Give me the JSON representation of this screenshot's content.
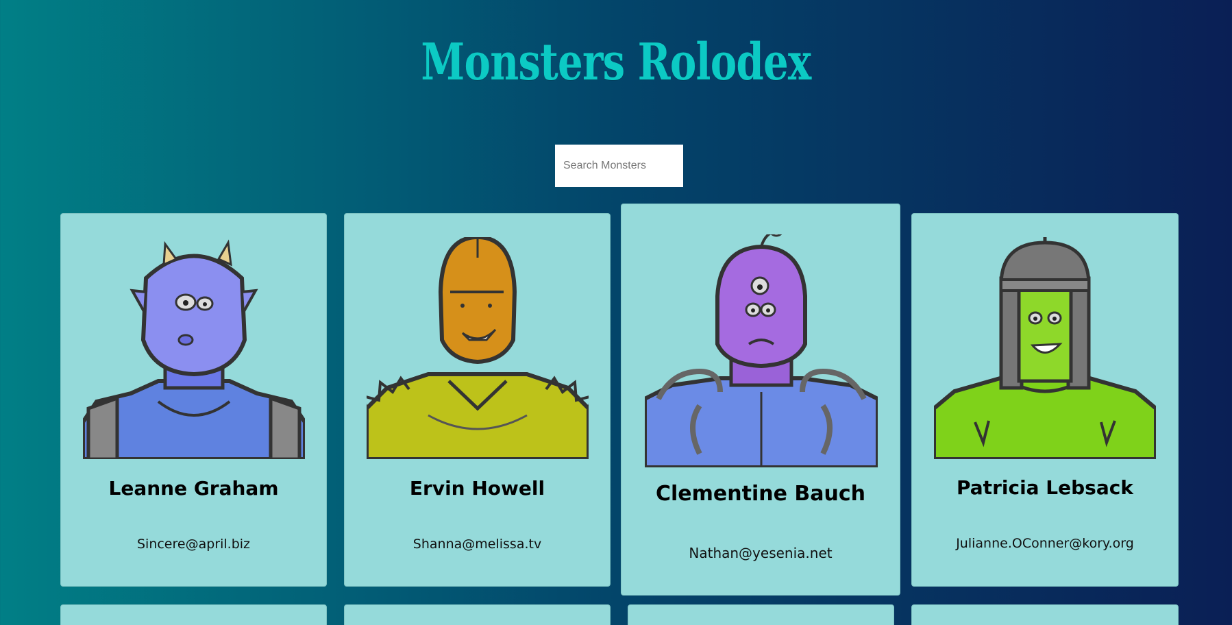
{
  "header": {
    "title": "Monsters Rolodex"
  },
  "search": {
    "placeholder": "Search Monsters"
  },
  "monsters": [
    {
      "name": "Leanne Graham",
      "email": "Sincere@april.biz",
      "color": "#8b8ff0",
      "icon": "horned-monster-avatar"
    },
    {
      "name": "Ervin Howell",
      "email": "Shanna@melissa.tv",
      "color": "#d6901a",
      "icon": "spiky-monster-avatar"
    },
    {
      "name": "Clementine Bauch",
      "email": "Nathan@yesenia.net",
      "color": "#a56be0",
      "icon": "three-eyed-monster-avatar"
    },
    {
      "name": "Patricia Lebsack",
      "email": "Julianne.OConner@kory.org",
      "color": "#7fd21a",
      "icon": "helmet-monster-avatar"
    }
  ],
  "colors": {
    "card_background": "#95dada",
    "title_color": "#0ccac4",
    "gradient_left": "#017f86",
    "gradient_right": "#0a1f55"
  }
}
